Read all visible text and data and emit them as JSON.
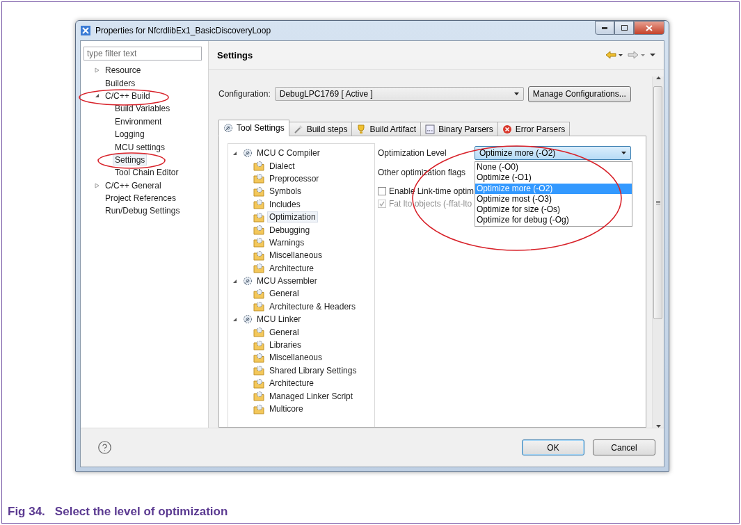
{
  "window": {
    "title": "Properties for NfcrdlibEx1_BasicDiscoveryLoop"
  },
  "filter": {
    "placeholder": "type filter text"
  },
  "nav": [
    {
      "label": "Resource",
      "expanded": false,
      "selected": false
    },
    {
      "label": "Builders",
      "selected": false
    },
    {
      "label": "C/C++ Build",
      "expanded": true,
      "selected": false,
      "children": [
        {
          "label": "Build Variables",
          "selected": false
        },
        {
          "label": "Environment",
          "selected": false
        },
        {
          "label": "Logging",
          "selected": false
        },
        {
          "label": "MCU settings",
          "selected": false
        },
        {
          "label": "Settings",
          "selected": true
        },
        {
          "label": "Tool Chain Editor",
          "selected": false
        }
      ]
    },
    {
      "label": "C/C++ General",
      "expanded": false,
      "selected": false
    },
    {
      "label": "Project References",
      "selected": false
    },
    {
      "label": "Run/Debug Settings",
      "selected": false
    }
  ],
  "page_title": "Settings",
  "configuration": {
    "label": "Configuration:",
    "value": "DebugLPC1769  [ Active ]",
    "button": "Manage Configurations..."
  },
  "tabs": [
    {
      "label": "Tool Settings",
      "kind": "gear",
      "selected": true
    },
    {
      "label": "Build steps",
      "kind": "wand",
      "selected": false
    },
    {
      "label": "Build Artifact",
      "kind": "artifact",
      "selected": false
    },
    {
      "label": "Binary Parsers",
      "kind": "binary",
      "selected": false
    },
    {
      "label": "Error Parsers",
      "kind": "error",
      "selected": false
    }
  ],
  "tool_tree": [
    {
      "label": "MCU C Compiler",
      "expanded": true,
      "children": [
        {
          "label": "Dialect",
          "selected": false
        },
        {
          "label": "Preprocessor",
          "selected": false
        },
        {
          "label": "Symbols",
          "selected": false
        },
        {
          "label": "Includes",
          "selected": false
        },
        {
          "label": "Optimization",
          "selected": true
        },
        {
          "label": "Debugging",
          "selected": false
        },
        {
          "label": "Warnings",
          "selected": false
        },
        {
          "label": "Miscellaneous",
          "selected": false
        },
        {
          "label": "Architecture",
          "selected": false
        }
      ]
    },
    {
      "label": "MCU Assembler",
      "expanded": true,
      "children": [
        {
          "label": "General",
          "selected": false
        },
        {
          "label": "Architecture & Headers",
          "selected": false
        }
      ]
    },
    {
      "label": "MCU Linker",
      "expanded": true,
      "children": [
        {
          "label": "General",
          "selected": false
        },
        {
          "label": "Libraries",
          "selected": false
        },
        {
          "label": "Miscellaneous",
          "selected": false
        },
        {
          "label": "Shared Library Settings",
          "selected": false
        },
        {
          "label": "Architecture",
          "selected": false
        },
        {
          "label": "Managed Linker Script",
          "selected": false
        },
        {
          "label": "Multicore",
          "selected": false
        }
      ]
    }
  ],
  "optimization": {
    "label": "Optimization Level",
    "value": "Optimize more (-O2)",
    "options": [
      {
        "label": "None (-O0)",
        "selected": false
      },
      {
        "label": "Optimize (-O1)",
        "selected": false
      },
      {
        "label": "Optimize more (-O2)",
        "selected": true
      },
      {
        "label": "Optimize most (-O3)",
        "selected": false
      },
      {
        "label": "Optimize for size (-Os)",
        "selected": false
      },
      {
        "label": "Optimize for debug (-Og)",
        "selected": false
      }
    ]
  },
  "other_flags_label": "Other optimization flags",
  "checkboxes": [
    {
      "label": "Enable Link-time optim",
      "checked": false,
      "disabled": false
    },
    {
      "label": "Fat lto objects (-ffat-lto",
      "checked": true,
      "disabled": true
    }
  ],
  "buttons": [
    {
      "label": "OK",
      "default": true
    },
    {
      "label": "Cancel",
      "default": false
    }
  ],
  "caption": {
    "number": "Fig 34.",
    "text": "Select the level of optimization"
  }
}
